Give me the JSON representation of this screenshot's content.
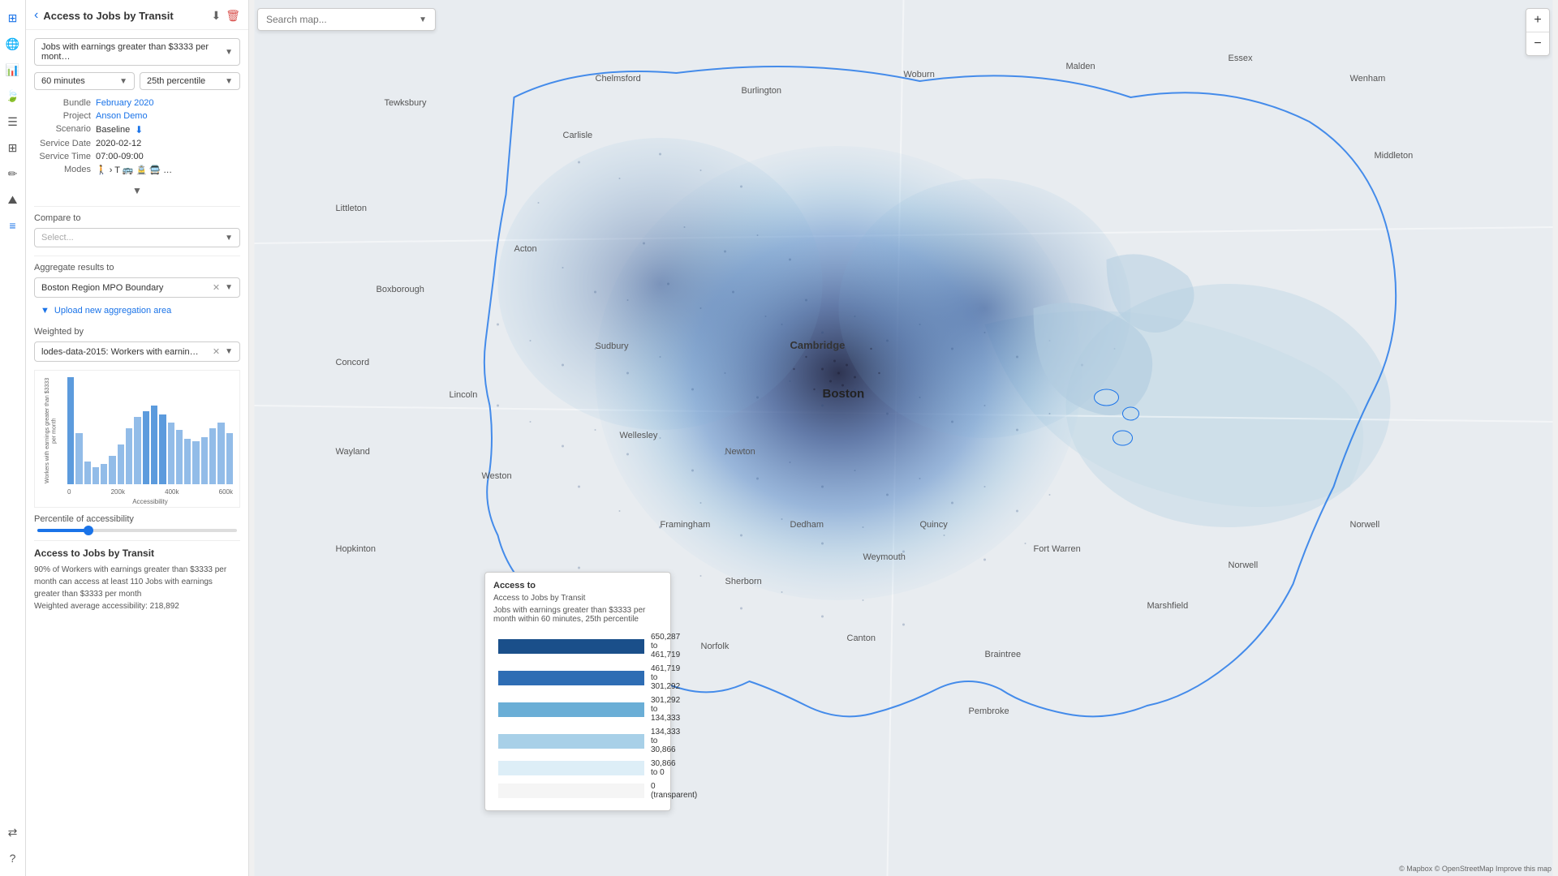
{
  "app": {
    "title": "Access to Jobs by Transit",
    "back_label": "‹",
    "download_icon": "⬇",
    "delete_icon": "🗑"
  },
  "icon_bar": {
    "items": [
      {
        "id": "layers",
        "icon": "⊞",
        "active": false
      },
      {
        "id": "globe",
        "icon": "🌐",
        "active": false
      },
      {
        "id": "chart",
        "icon": "📊",
        "active": false
      },
      {
        "id": "leaf",
        "icon": "🍃",
        "active": false
      },
      {
        "id": "list",
        "icon": "☰",
        "active": false
      },
      {
        "id": "grid",
        "icon": "⊞",
        "active": false
      },
      {
        "id": "pencil",
        "icon": "✏",
        "active": false
      },
      {
        "id": "mountain",
        "icon": "⛰",
        "active": false
      },
      {
        "id": "lines",
        "icon": "≡",
        "active": true
      }
    ],
    "bottom_items": [
      {
        "id": "arrows",
        "icon": "⇄"
      },
      {
        "id": "help",
        "icon": "?"
      }
    ]
  },
  "panel": {
    "main_dropdown": {
      "value": "Jobs with earnings greater than $3333 per month",
      "display": "Jobs with earnings greater than $3333 per mont…"
    },
    "time_dropdown": {
      "value": "60 minutes",
      "display": "60 minutes"
    },
    "percentile_dropdown": {
      "value": "25th percentile",
      "display": "25th percentile"
    },
    "bundle_label": "Bundle",
    "bundle_value": "February 2020",
    "project_label": "Project",
    "project_value": "Anson Demo",
    "scenario_label": "Scenario",
    "scenario_value": "Baseline",
    "service_date_label": "Service Date",
    "service_date_value": "2020-02-12",
    "service_time_label": "Service Time",
    "service_time_value": "07:00-09:00",
    "modes_label": "Modes",
    "modes_icons": "🚶 › T 🚌 🚊 🚍 …",
    "compare_label": "Compare to",
    "compare_placeholder": "Select...",
    "aggregate_label": "Aggregate results to",
    "aggregate_value": "Boston Region MPO Boundary",
    "upload_label": "Upload new aggregation area",
    "weighted_label": "Weighted by",
    "weighted_value": "lodes-data-2015: Workers with earnin…",
    "percentile_of_accessibility": "Percentile of accessibility",
    "access_section_title": "Access to Jobs by Transit",
    "access_description": "90% of Workers with earnings greater than $3333 per month can access at least 110 Jobs with earnings greater than $3333 per month\nWeighted average accessibility: 218,892"
  },
  "histogram": {
    "y_label": "Workers with earnings greater than $3333 per month",
    "x_label": "Accessibility",
    "x_ticks": [
      "0",
      "200k",
      "400k",
      "600k"
    ],
    "bars": [
      95,
      45,
      20,
      15,
      18,
      25,
      35,
      50,
      60,
      65,
      70,
      62,
      55,
      48,
      40,
      38,
      42,
      50,
      55,
      45
    ]
  },
  "map": {
    "search_placeholder": "Search map...",
    "zoom_in": "+",
    "zoom_out": "−",
    "attribution": "© Mapbox © OpenStreetMap Improve this map"
  },
  "legend": {
    "title": "Access to",
    "subtitle": "Access to Jobs by Transit",
    "description": "Jobs with earnings greater than $3333 per month within 60 minutes, 25th percentile",
    "items": [
      {
        "label": "650,287 to 461,719",
        "color": "#1a4f8a"
      },
      {
        "label": "461,719 to 301,292",
        "color": "#2e6db4"
      },
      {
        "label": "301,292 to 134,333",
        "color": "#6aaed6"
      },
      {
        "label": "134,333 to 30,866",
        "color": "#a8d0e8"
      },
      {
        "label": "30,866 to 0",
        "color": "#ddeef7"
      },
      {
        "label": "0 (transparent)",
        "color": "#f5f5f5"
      }
    ]
  }
}
